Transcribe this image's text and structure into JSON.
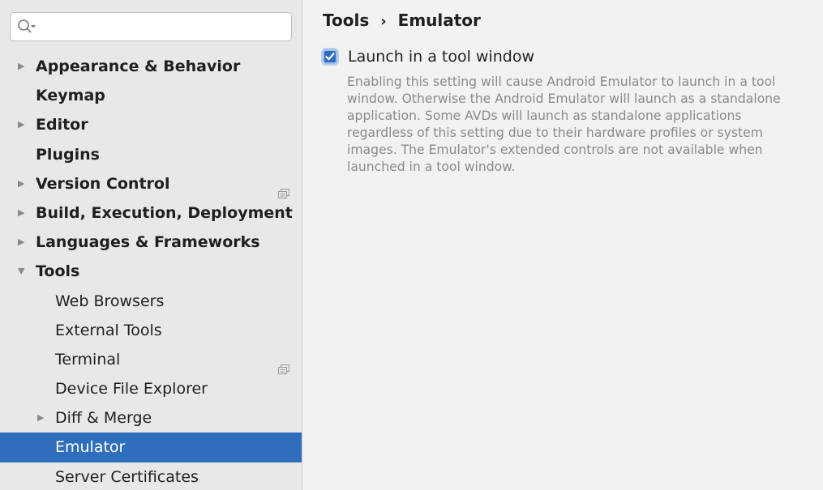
{
  "search": {
    "value": "",
    "placeholder": ""
  },
  "sidebar": {
    "items": [
      {
        "label": "Appearance & Behavior",
        "level": 0,
        "arrow": "right",
        "project_icon": false,
        "selected": false
      },
      {
        "label": "Keymap",
        "level": 0,
        "arrow": "none",
        "project_icon": false,
        "selected": false
      },
      {
        "label": "Editor",
        "level": 0,
        "arrow": "right",
        "project_icon": false,
        "selected": false
      },
      {
        "label": "Plugins",
        "level": 0,
        "arrow": "none",
        "project_icon": false,
        "selected": false
      },
      {
        "label": "Version Control",
        "level": 0,
        "arrow": "right",
        "project_icon": true,
        "selected": false
      },
      {
        "label": "Build, Execution, Deployment",
        "level": 0,
        "arrow": "right",
        "project_icon": false,
        "selected": false
      },
      {
        "label": "Languages & Frameworks",
        "level": 0,
        "arrow": "right",
        "project_icon": false,
        "selected": false
      },
      {
        "label": "Tools",
        "level": 0,
        "arrow": "down",
        "project_icon": false,
        "selected": false
      },
      {
        "label": "Web Browsers",
        "level": 1,
        "arrow": "none",
        "project_icon": false,
        "selected": false
      },
      {
        "label": "External Tools",
        "level": 1,
        "arrow": "none",
        "project_icon": false,
        "selected": false
      },
      {
        "label": "Terminal",
        "level": 1,
        "arrow": "none",
        "project_icon": true,
        "selected": false
      },
      {
        "label": "Device File Explorer",
        "level": 1,
        "arrow": "none",
        "project_icon": false,
        "selected": false
      },
      {
        "label": "Diff & Merge",
        "level": 1,
        "arrow": "right",
        "project_icon": false,
        "selected": false
      },
      {
        "label": "Emulator",
        "level": 1,
        "arrow": "none",
        "project_icon": false,
        "selected": true
      },
      {
        "label": "Server Certificates",
        "level": 1,
        "arrow": "none",
        "project_icon": false,
        "selected": false
      }
    ]
  },
  "breadcrumb": {
    "parent": "Tools",
    "separator": "›",
    "current": "Emulator"
  },
  "settings": {
    "launch_in_tool_window": {
      "label": "Launch in a tool window",
      "checked": true,
      "description": "Enabling this setting will cause Android Emulator to launch in a tool window. Otherwise the Android Emulator will launch as a standalone application. Some AVDs will launch as standalone applications regardless of this setting due to their hardware profiles or system images. The Emulator's extended controls are not available when launched in a tool window."
    }
  },
  "colors": {
    "selection": "#2f6dbd",
    "sidebar_bg": "#e8e8e8",
    "panel_bg": "#f2f2f2",
    "description_text": "#8a8a8a"
  }
}
